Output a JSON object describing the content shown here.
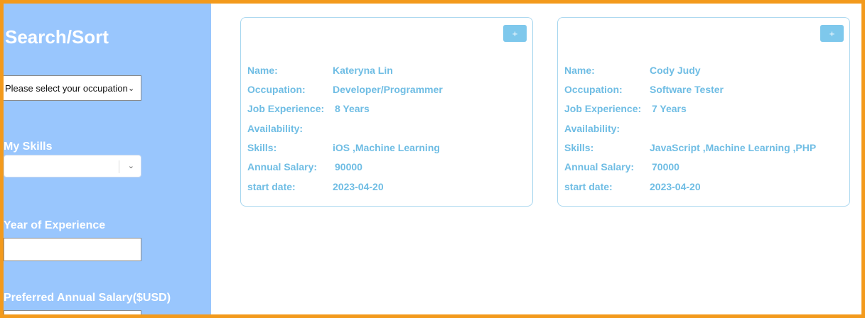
{
  "sidebar": {
    "title": "Search/Sort",
    "occupation_select": {
      "value": "Please select your occupation"
    },
    "skills_label": "My Skills",
    "experience_label": "Year of Experience",
    "salary_label": "Preferred Annual Salary($USD)"
  },
  "card_labels": {
    "name": "Name:",
    "occupation": "Occupation:",
    "experience": "Job Experience:",
    "availability": "Availability:",
    "skills": "Skills:",
    "salary": "Annual Salary:",
    "start": "start date:"
  },
  "cards": [
    {
      "add_label": "+",
      "name": "Kateryna Lin",
      "occupation": "Developer/Programmer",
      "experience": "8 Years",
      "availability": "",
      "skills": "iOS ,Machine Learning",
      "salary": "90000",
      "start": "2023-04-20"
    },
    {
      "add_label": "+",
      "name": "Cody Judy",
      "occupation": "Software Tester",
      "experience": "7 Years",
      "availability": "",
      "skills": "JavaScript ,Machine Learning ,PHP",
      "salary": "70000",
      "start": "2023-04-20"
    }
  ],
  "colors": {
    "frame": "#f39a1c",
    "sidebar": "#99c6fd",
    "card_text": "#6fbde4",
    "card_border": "#a9d7ef",
    "button": "#7ec8ec"
  }
}
